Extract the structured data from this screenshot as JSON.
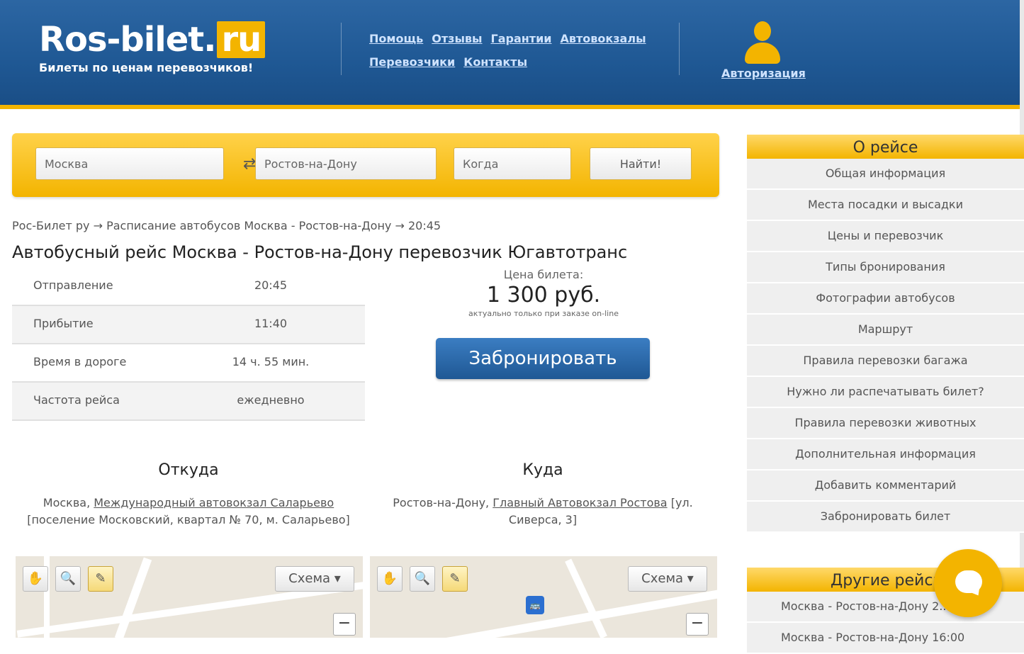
{
  "header": {
    "logo_main": "Ros-bilet.",
    "logo_ru": "ru",
    "tagline": "Билеты по ценам перевозчиков!",
    "nav": [
      "Помощь",
      "Отзывы",
      "Гарантии",
      "Автовокзалы",
      "Перевозчики",
      "Контакты"
    ],
    "auth_label": "Авторизация"
  },
  "search": {
    "from": "Москва",
    "to": "Ростов-на-Дону",
    "date_placeholder": "Когда",
    "swap_icon": "⇄",
    "submit_label": "Найти!"
  },
  "breadcrumb": "Рос-Билет ру → Расписание автобусов Москва - Ростов-на-Дону → 20:45",
  "title": "Автобусный рейс Москва - Ростов-на-Дону перевозчик Югавтотранс",
  "info": [
    {
      "label": "Отправление",
      "value": "20:45"
    },
    {
      "label": "Прибытие",
      "value": "11:40"
    },
    {
      "label": "Время в дороге",
      "value": "14 ч. 55 мин."
    },
    {
      "label": "Частота рейса",
      "value": "ежедневно"
    }
  ],
  "price": {
    "label": "Цена билета:",
    "value": "1 300 руб.",
    "note": "актуально только при заказе on-line",
    "book_label": "Забронировать"
  },
  "from": {
    "heading": "Откуда",
    "city": "Москва,",
    "station": "Международный автовокзал Саларьево",
    "address": "[поселение Московский, квартал № 70, м. Саларьево]"
  },
  "to": {
    "heading": "Куда",
    "city": "Ростов-на-Дону,",
    "station": "Главный Автовокзал Ростова",
    "address": "[ул. Сиверса, 3]"
  },
  "map": {
    "layer_label": "Схема ▾",
    "zoom_out": "−",
    "bus_marker": "🚌"
  },
  "sidebar": {
    "heading": "О рейсе",
    "items": [
      "Общая информация",
      "Места посадки и высадки",
      "Цены и перевозчик",
      "Типы бронирования",
      "Фотографии автобусов",
      "Маршрут",
      "Правила перевозки багажа",
      "Нужно ли распечатывать билет?",
      "Правила перевозки животных",
      "Дополнительная информация",
      "Добавить комментарий",
      "Забронировать билет"
    ]
  },
  "sidebar2": {
    "heading": "Другие рейсы",
    "items": [
      "Москва - Ростов-на-Дону 2...",
      "Москва - Ростов-на-Дону 16:00"
    ]
  },
  "colors": {
    "header_blue": "#1f5894",
    "accent_yellow": "#f3b400"
  }
}
